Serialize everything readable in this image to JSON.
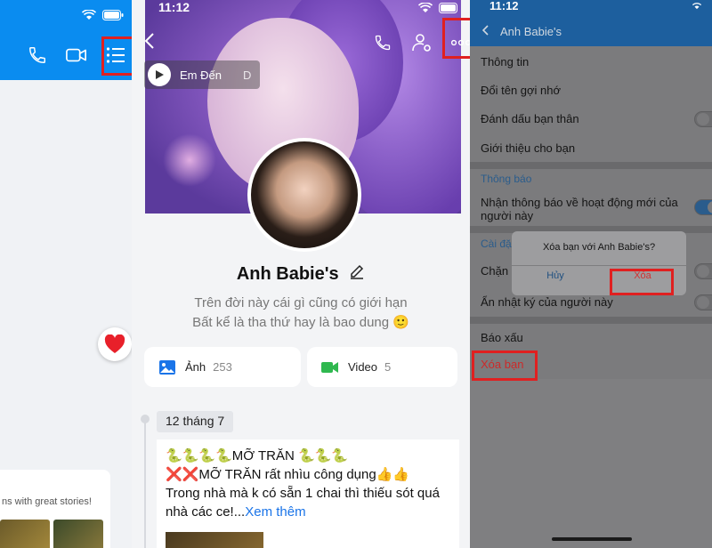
{
  "panel_left": {
    "header_icons": [
      "phone-icon",
      "video-icon",
      "list-icon"
    ],
    "status_icons": [
      "wifi-icon",
      "battery-icon"
    ],
    "reaction_icon": "heart-icon",
    "card_text": "ns with great stories!"
  },
  "panel_profile": {
    "status_time": "11:12",
    "music_label": "Em Đến",
    "music_tail": "D",
    "name": "Anh Babie's",
    "bio_line1": "Trên đời này cái gì cũng có giới hạn",
    "bio_line2": "Bất kể là tha thứ hay là bao dung 🙂",
    "photos_label": "Ảnh",
    "photos_count": "253",
    "video_label": "Video",
    "video_count": "5",
    "timeline_date": "12 tháng 7",
    "post_line1": "🐍🐍🐍🐍MỠ TRĂN 🐍🐍🐍",
    "post_line2": "❌❌MỠ TRĂN rất nhìu công dụng👍👍",
    "post_line3": "Trong nhà mà k có sẵn 1 chai thì thiếu sót quá",
    "post_line4": "nhà các ce!...",
    "post_more": "Xem thêm",
    "colors": {
      "accent": "#1a74e8",
      "photos_icon": "#1a74e8",
      "video_icon": "#2fb84f"
    }
  },
  "panel_settings": {
    "status_time": "11:12",
    "title": "Anh Babie's",
    "items": {
      "info": "Thông tin",
      "rename": "Đổi tên gợi nhớ",
      "close_friend": "Đánh dấu bạn thân",
      "introduce": "Giới thiệu cho bạn",
      "notify_section": "Thông báo",
      "notify_activity_1": "Nhận thông báo về hoạt động mới của",
      "notify_activity_2": "người này",
      "settings_section": "Cài đặ",
      "block": "Chặn",
      "hide_diary": "Ẩn nhật ký của người này",
      "report": "Báo xấu",
      "unfriend": "Xóa bạn"
    },
    "dialog": {
      "message": "Xóa bạn với Anh Babie's?",
      "cancel": "Hủy",
      "confirm": "Xóa"
    },
    "colors": {
      "header": "#1d5f9e",
      "danger": "#cc2a2a",
      "highlight": "#e02020"
    }
  }
}
